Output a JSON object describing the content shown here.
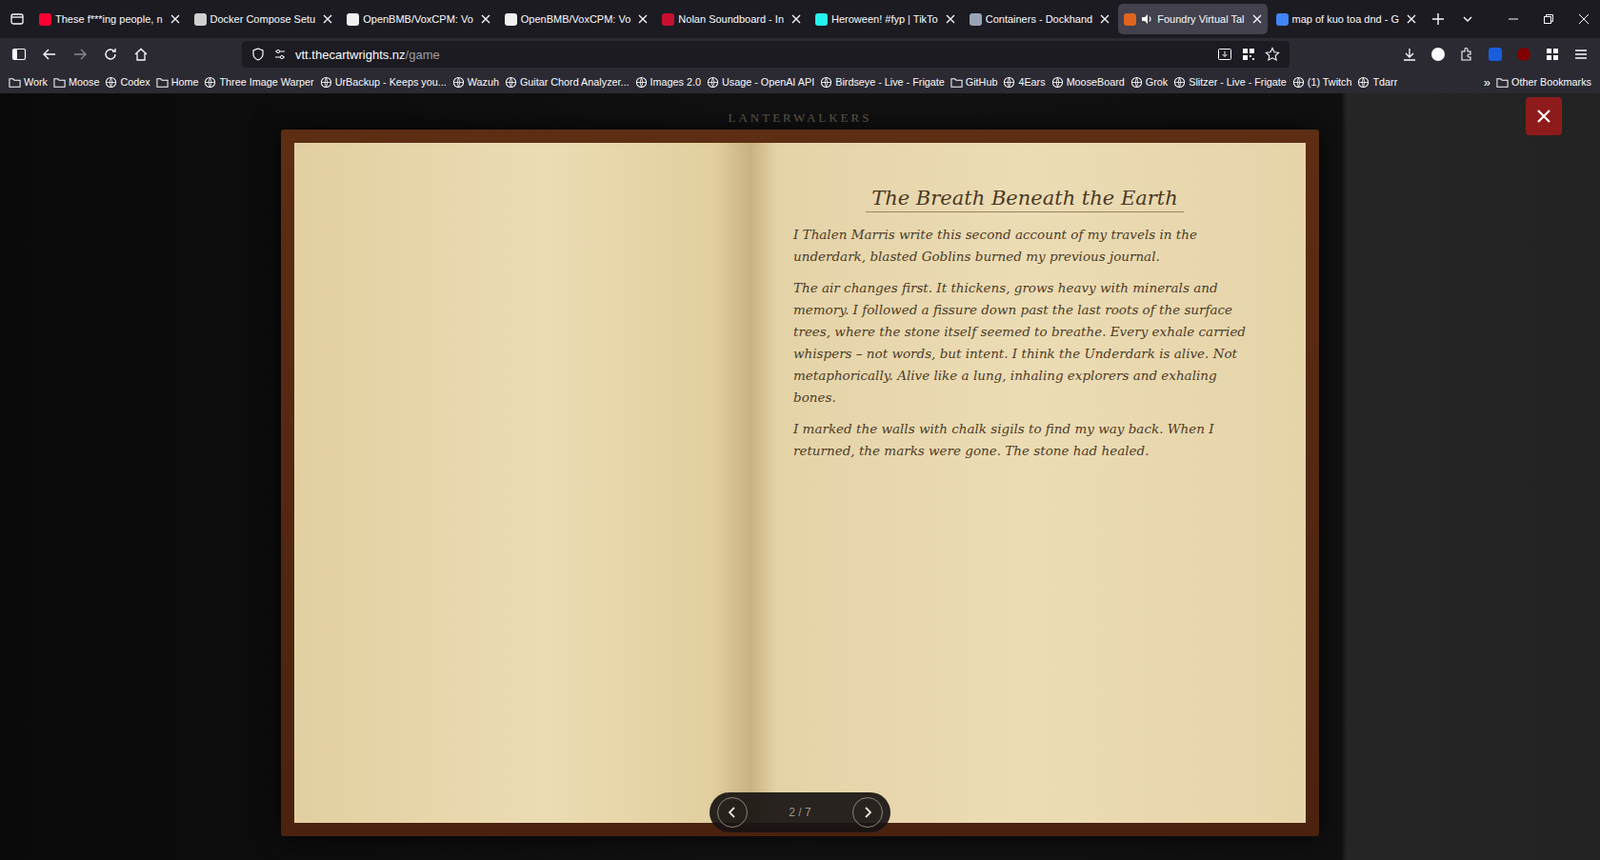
{
  "browser": {
    "tabs": [
      {
        "label": "These f***ing people, n",
        "selected": false,
        "audio": false,
        "color": "#ff0033"
      },
      {
        "label": "Docker Compose Setu",
        "selected": false,
        "audio": false,
        "color": "#d0d0d0"
      },
      {
        "label": "OpenBMB/VoxCPM: Vo",
        "selected": false,
        "audio": false,
        "color": "#f0f0f0"
      },
      {
        "label": "OpenBMB/VoxCPM: Vo",
        "selected": false,
        "audio": false,
        "color": "#f0f0f0"
      },
      {
        "label": "Nolan Soundboard - In",
        "selected": false,
        "audio": false,
        "color": "#c8102e"
      },
      {
        "label": "Heroween! #fyp | TikTo",
        "selected": false,
        "audio": false,
        "color": "#25f4ee"
      },
      {
        "label": "Containers - Dockhand",
        "selected": false,
        "audio": false,
        "color": "#9aa4b5"
      },
      {
        "label": "Foundry Virtual Tal",
        "selected": true,
        "audio": true,
        "color": "#e0641f"
      },
      {
        "label": "map of kuo toa dnd - G",
        "selected": false,
        "audio": false,
        "color": "#4285f4"
      }
    ]
  },
  "toolbar": {
    "url_host": "vtt.thecartwrights.nz",
    "url_path": "/game"
  },
  "bookmarks": [
    {
      "label": "Work",
      "kind": "folder"
    },
    {
      "label": "Moose",
      "kind": "folder"
    },
    {
      "label": "Codex",
      "kind": "site"
    },
    {
      "label": "Home",
      "kind": "folder"
    },
    {
      "label": "Three Image Warper",
      "kind": "site"
    },
    {
      "label": "UrBackup - Keeps you...",
      "kind": "site"
    },
    {
      "label": "Wazuh",
      "kind": "site"
    },
    {
      "label": "Guitar Chord Analyzer...",
      "kind": "site"
    },
    {
      "label": "Images 2.0",
      "kind": "site"
    },
    {
      "label": "Usage - OpenAI API",
      "kind": "site"
    },
    {
      "label": "Birdseye - Live - Frigate",
      "kind": "site"
    },
    {
      "label": "GitHub",
      "kind": "folder"
    },
    {
      "label": "4Ears",
      "kind": "site"
    },
    {
      "label": "MooseBoard",
      "kind": "site"
    },
    {
      "label": "Grok",
      "kind": "site"
    },
    {
      "label": "Slitzer - Live - Frigate",
      "kind": "site"
    },
    {
      "label": "(1) Twitch",
      "kind": "site"
    },
    {
      "label": "Tdarr",
      "kind": "site"
    }
  ],
  "bookmarks_overflow": "»",
  "other_bookmarks": "Other Bookmarks",
  "journal": {
    "header": "LANTERWALKERS",
    "title": "The Breath Beneath the Earth",
    "paragraphs": [
      "I Thalen Marris write this second account of my travels in the underdark, blasted Goblins burned my previous journal.",
      "The air changes first. It thickens, grows heavy with minerals and memory. I followed a fissure down past the last roots of the surface trees, where the stone itself seemed to breathe. Every exhale carried whispers – not words, but intent. I think the Underdark is alive. Not metaphorically. Alive like a lung, inhaling explorers and exhaling bones.",
      "I marked the walls with chalk sigils to find my way back. When I returned, the marks were gone. The stone had healed."
    ],
    "page": "2 / 7"
  }
}
